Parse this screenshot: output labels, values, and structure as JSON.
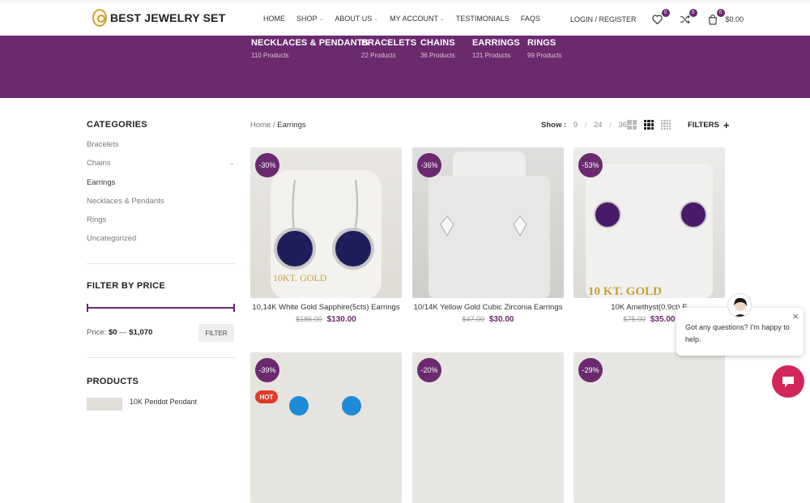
{
  "header": {
    "logo": "BEST JEWELRY SET",
    "nav": [
      {
        "label": "HOME",
        "caret": false
      },
      {
        "label": "SHOP",
        "caret": true
      },
      {
        "label": "ABOUT US",
        "caret": true
      },
      {
        "label": "MY ACCOUNT",
        "caret": true
      },
      {
        "label": "TESTIMONIALS",
        "caret": false
      },
      {
        "label": "FAQS",
        "caret": false
      }
    ],
    "login": "LOGIN / REGISTER",
    "wishlist_count": "0",
    "compare_count": "0",
    "cart_count": "0",
    "cart_total": "$0.00"
  },
  "categories_bar": [
    {
      "name": "NECKLACES & PENDANTS",
      "count": "110 Products"
    },
    {
      "name": "BRACELETS",
      "count": "22 Products"
    },
    {
      "name": "CHAINS",
      "count": "36 Products"
    },
    {
      "name": "EARRINGS",
      "count": "121 Products"
    },
    {
      "name": "RINGS",
      "count": "99 Products"
    }
  ],
  "sidebar": {
    "categories_title": "CATEGORIES",
    "categories": [
      "Bracelets",
      "Chains",
      "Earrings",
      "Necklaces & Pendants",
      "Rings",
      "Uncategorized"
    ],
    "filter_title": "FILTER BY PRICE",
    "price_label": "Price:",
    "price_min": "$0",
    "price_dash": "—",
    "price_max": "$1,070",
    "filter_button": "FILTER",
    "products_title": "PRODUCTS",
    "product_name": "10K Peridot Pendant"
  },
  "toolbar": {
    "crumb_home": "Home",
    "crumb_sep": "/",
    "crumb_current": "Earrings",
    "show_label": "Show :",
    "show_options": [
      "9",
      "24",
      "36"
    ],
    "filters_label": "FILTERS"
  },
  "products": [
    {
      "discount": "-30%",
      "title": "10,14K White Gold Sapphire(5cts) Earrings",
      "old_price": "$186.00",
      "new_price": "$130.00"
    },
    {
      "discount": "-36%",
      "title": "10/14K Yellow Gold Cubic Zirconia Earrings",
      "old_price": "$47.00",
      "new_price": "$30.00"
    },
    {
      "discount": "-53%",
      "title": "10K Amethyst(0.9ct) E",
      "old_price": "$75.00",
      "new_price": "$35.00"
    },
    {
      "discount": "-39%",
      "hot": "HOT"
    },
    {
      "discount": "-20%"
    },
    {
      "discount": "-29%"
    }
  ],
  "chat": {
    "message": "Got any questions? I'm happy to help."
  },
  "colors": {
    "brand": "#6b2a6e",
    "chat": "#d2265b"
  }
}
